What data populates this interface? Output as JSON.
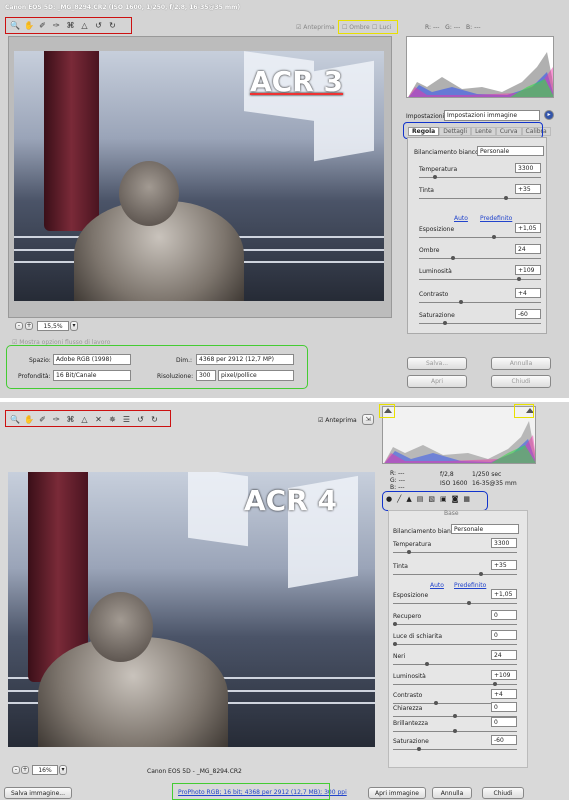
{
  "acr3": {
    "title": "Canon EOS 5D:  _MG_8294.CR2  (ISO 1600, 1/250, f/2.8, 16-35@35 mm)",
    "preview_opts": {
      "anteprima": "Anteprima",
      "ombre": "Ombre",
      "luci": "Luci"
    },
    "rgb": {
      "r": "R:",
      "g": "G:",
      "b": "B:",
      "r_val": "---",
      "g_val": "---",
      "b_val": "---"
    },
    "overlay_label": "ACR 3",
    "zoom": "15,5%",
    "settings_label": "Impostazioni:",
    "settings_value": "Impostazioni immagine",
    "tabs": [
      "Regola",
      "Dettagli",
      "Lente",
      "Curva",
      "Calibra"
    ],
    "wb_label": "Bilanciamento bianco:",
    "wb_value": "Personale",
    "auto": "Auto",
    "default": "Predefinito",
    "sliders": [
      {
        "label": "Temperatura",
        "value": "3300",
        "pos": 0.12
      },
      {
        "label": "Tinta",
        "value": "+35",
        "pos": 0.72
      },
      {
        "label": "Esposizione",
        "value": "+1,05",
        "pos": 0.62
      },
      {
        "label": "Ombre",
        "value": "24",
        "pos": 0.27
      },
      {
        "label": "Luminosità",
        "value": "+109",
        "pos": 0.83
      },
      {
        "label": "Contrasto",
        "value": "+4",
        "pos": 0.34
      },
      {
        "label": "Saturazione",
        "value": "-60",
        "pos": 0.2
      }
    ],
    "workflow_toggle": "Mostra opzioni flusso di lavoro",
    "workflow": {
      "spazio_label": "Spazio:",
      "spazio_value": "Adobe RGB (1998)",
      "dim_label": "Dim.:",
      "dim_value": "4368 per 2912 (12,7 MP)",
      "prof_label": "Profondità:",
      "prof_value": "16 Bit/Canale",
      "ris_label": "Risoluzione:",
      "ris_value": "300",
      "ris_unit": "pixel/pollice"
    },
    "buttons": {
      "save": "Salva...",
      "cancel": "Annulla",
      "open": "Apri",
      "close": "Chiudi"
    },
    "colors": {
      "red": "#cc1111",
      "blue": "#1133cc",
      "yellow": "#e8e000",
      "green": "#44cc33"
    }
  },
  "acr4": {
    "anteprima": "Anteprima",
    "overlay_label": "ACR 4",
    "camera_info": {
      "r": "R:",
      "g": "G:",
      "b": "B:",
      "r_val": "---",
      "g_val": "---",
      "b_val": "---",
      "aperture": "f/2,8",
      "shutter": "1/250 sec",
      "iso": "ISO 1600",
      "lens": "16-35@35 mm"
    },
    "panel_title": "Base",
    "wb_label": "Bilanciamento bianco:",
    "wb_value": "Personale",
    "auto": "Auto",
    "default": "Predefinito",
    "sliders": [
      {
        "label": "Temperatura",
        "value": "3300",
        "pos": 0.12
      },
      {
        "label": "Tinta",
        "value": "+35",
        "pos": 0.72
      },
      {
        "label": "Esposizione",
        "value": "+1,05",
        "pos": 0.62
      },
      {
        "label": "Recupero",
        "value": "0",
        "pos": 0.0
      },
      {
        "label": "Luce di schiarita",
        "value": "0",
        "pos": 0.0
      },
      {
        "label": "Neri",
        "value": "24",
        "pos": 0.27
      },
      {
        "label": "Luminosità",
        "value": "+109",
        "pos": 0.83
      },
      {
        "label": "Contrasto",
        "value": "+4",
        "pos": 0.34
      },
      {
        "label": "Chiarezza",
        "value": "0",
        "pos": 0.5
      },
      {
        "label": "Brillantezza",
        "value": "0",
        "pos": 0.5
      },
      {
        "label": "Saturazione",
        "value": "-60",
        "pos": 0.2
      }
    ],
    "zoom": "16%",
    "filename": "Canon EOS 5D  -  _MG_8294.CR2",
    "workflow_link": "ProPhoto RGB; 16 bit; 4368 per 2912 (12,7 MB); 300 ppi",
    "buttons": {
      "save": "Salva immagine...",
      "open": "Apri immagine",
      "cancel": "Annulla",
      "close": "Chiudi"
    }
  }
}
